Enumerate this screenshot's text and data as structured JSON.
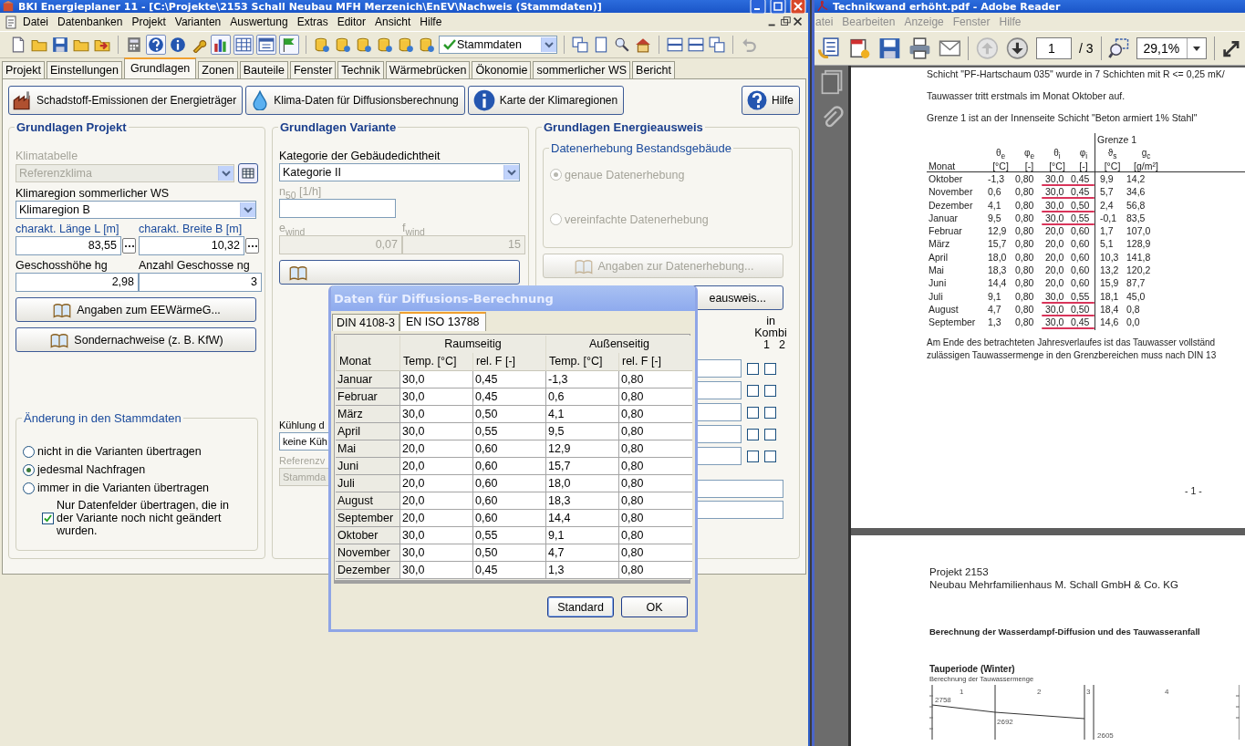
{
  "main_window": {
    "title": "BKI Energieplaner 11 - [C:\\Projekte\\2153 Schall Neubau MFH Merzenich\\EnEV\\Nachweis (Stammdaten)]",
    "menu": [
      "Datei",
      "Datenbanken",
      "Projekt",
      "Varianten",
      "Auswertung",
      "Extras",
      "Editor",
      "Ansicht",
      "Hilfe"
    ],
    "view_select": "Stammdaten",
    "tabs": [
      {
        "label": "Projekt",
        "selected": false
      },
      {
        "label": "Einstellungen",
        "selected": false
      },
      {
        "label": "Grundlagen",
        "selected": true
      },
      {
        "label": "Zonen",
        "selected": false
      },
      {
        "label": "Bauteile",
        "selected": false
      },
      {
        "label": "Fenster",
        "selected": false
      },
      {
        "label": "Technik",
        "selected": false
      },
      {
        "label": "Wärmebrücken",
        "selected": false
      },
      {
        "label": "Ökonomie",
        "selected": false
      },
      {
        "label": "sommerlicher WS",
        "selected": false
      },
      {
        "label": "Bericht",
        "selected": false
      }
    ],
    "action_buttons": [
      {
        "label": "Schadstoff-Emissionen der Energieträger",
        "kind": "factory"
      },
      {
        "label": "Klima-Daten für Diffusionsberechnung",
        "kind": "droplet"
      },
      {
        "label": "Karte der Klimaregionen",
        "kind": "info"
      }
    ],
    "help_button": "Hilfe",
    "project_group": {
      "title": "Grundlagen Projekt",
      "climate_table": {
        "label": "Klimatabelle",
        "value": "Referenzklima",
        "disabled": true
      },
      "summer_region": {
        "label": "Klimaregion sommerlicher WS",
        "value": "Klimaregion B"
      },
      "length": {
        "label": "charakt. Länge L [m]",
        "value": "83,55"
      },
      "width": {
        "label": "charakt. Breite B [m]",
        "value": "10,32"
      },
      "storey_height": {
        "label": "Geschosshöhe hg",
        "value": "2,98"
      },
      "storey_count": {
        "label": "Anzahl Geschosse ng",
        "value": "3"
      },
      "buttons": [
        "Angaben zum EEWärmeG...",
        "Sondernachweise (z. B. KfW)"
      ],
      "changes": {
        "title": "Änderung in den Stammdaten",
        "options": [
          {
            "label": "nicht in die Varianten übertragen",
            "selected": false
          },
          {
            "label": "jedesmal Nachfragen",
            "selected": true
          },
          {
            "label": "immer in die Varianten übertragen",
            "selected": false
          }
        ],
        "only_unchanged": {
          "label": "Nur Datenfelder übertragen, die in der Variante noch nicht geändert wurden.",
          "checked": true
        }
      }
    },
    "variant_group": {
      "title": "Grundlagen Variante",
      "airtightness": {
        "label": "Kategorie der Gebäudedichtheit",
        "value": "Kategorie II"
      },
      "n50": {
        "label": "n$_{50}$  [1/h]",
        "disabled": true
      },
      "e_wind": {
        "label": "e$_{wind}$",
        "value": "0,07",
        "disabled": true
      },
      "f_wind": {
        "label": "f$_{wind}$",
        "value": "15",
        "disabled": true
      },
      "cooling": {
        "label": "Kühlung d",
        "value": "keine Küh"
      },
      "reference": {
        "label": "Referenzv",
        "value": "Stammda",
        "disabled": true
      }
    },
    "certificate_group": {
      "title": "Grundlagen Energieausweis",
      "survey": {
        "title": "Datenerhebung Bestandsgebäude",
        "disabled": true,
        "options": [
          {
            "label": "genaue Datenerhebung",
            "selected": true
          },
          {
            "label": "vereinfachte Datenerhebung",
            "selected": false
          }
        ]
      },
      "survey_button": {
        "label": "Angaben zur Datenerhebung...",
        "disabled": true
      },
      "partial_button": "eausweis...",
      "combi_header": {
        "label": "in Kombi",
        "col_1": "1",
        "col_2": "2"
      },
      "combi_rows": [
        {
          "combi_1": false,
          "combi_2": false
        },
        {
          "combi_1": false,
          "combi_2": false
        },
        {
          "combi_1": false,
          "combi_2": false
        },
        {
          "combi_1": false,
          "combi_2": false
        },
        {
          "combi_1": false,
          "combi_2": false
        }
      ]
    }
  },
  "dialog": {
    "title": "Daten für Diffusions-Berechnung",
    "tabs": [
      {
        "label": "DIN 4108-3",
        "selected": false
      },
      {
        "label": "EN ISO 13788",
        "selected": true
      }
    ],
    "group_headers": [
      "Raumseitig",
      "Außenseitig"
    ],
    "columns": [
      "Monat",
      "Temp. [°C]",
      "rel. F [-]",
      "Temp. [°C]",
      "rel. F [-]"
    ],
    "rows": [
      [
        "Januar",
        "30,0",
        "0,45",
        "-1,3",
        "0,80"
      ],
      [
        "Februar",
        "30,0",
        "0,45",
        "0,6",
        "0,80"
      ],
      [
        "März",
        "30,0",
        "0,50",
        "4,1",
        "0,80"
      ],
      [
        "April",
        "30,0",
        "0,55",
        "9,5",
        "0,80"
      ],
      [
        "Mai",
        "20,0",
        "0,60",
        "12,9",
        "0,80"
      ],
      [
        "Juni",
        "20,0",
        "0,60",
        "15,7",
        "0,80"
      ],
      [
        "Juli",
        "20,0",
        "0,60",
        "18,0",
        "0,80"
      ],
      [
        "August",
        "20,0",
        "0,60",
        "18,3",
        "0,80"
      ],
      [
        "September",
        "20,0",
        "0,60",
        "14,4",
        "0,80"
      ],
      [
        "Oktober",
        "30,0",
        "0,55",
        "9,1",
        "0,80"
      ],
      [
        "November",
        "30,0",
        "0,50",
        "4,7",
        "0,80"
      ],
      [
        "Dezember",
        "30,0",
        "0,45",
        "1,3",
        "0,80"
      ]
    ],
    "buttons": [
      "Standard",
      "OK"
    ]
  },
  "pdf_window": {
    "title": "Technikwand erhöht.pdf - Adobe Reader",
    "menu": [
      "atei",
      "Bearbeiten",
      "Anzeige",
      "Fenster",
      "Hilfe"
    ],
    "page_field": "1",
    "page_total": "/ 3",
    "zoom": "29,1%",
    "page_1": {
      "lines": [
        "Schicht \"PF-Hartschaum 035\" wurde in 7 Schichten mit R <= 0,25 mK/",
        "Tauwasser tritt erstmals im Monat Oktober auf.",
        "Grenze 1 ist an der Innenseite Schicht \"Beton armiert 1% Stahl\""
      ],
      "boundary_header": "Grenze 1",
      "columns": [
        {
          "symbol": "Monat"
        },
        {
          "symbol": "θ$_{e}$",
          "unit": "[°C]"
        },
        {
          "symbol": "φ$_{e}$",
          "unit": "[-]"
        },
        {
          "symbol": "θ$_{i}$",
          "unit": "[°C]"
        },
        {
          "symbol": "φ$_{i}$",
          "unit": "[-]"
        },
        {
          "symbol": "ϑ$_{s}$",
          "unit": "[°C]"
        },
        {
          "symbol": "g$_{c}$",
          "unit": "[g/m²]"
        }
      ],
      "rows": [
        {
          "cells": [
            "Oktober",
            "-1,3",
            "0,80",
            "30,0",
            "0,45",
            "9,9",
            "14,2"
          ],
          "marked": true
        },
        {
          "cells": [
            "November",
            "0,6",
            "0,80",
            "30,0",
            "0,45",
            "5,7",
            "34,6"
          ],
          "marked": true
        },
        {
          "cells": [
            "Dezember",
            "4,1",
            "0,80",
            "30,0",
            "0,50",
            "2,4",
            "56,8"
          ],
          "marked": true
        },
        {
          "cells": [
            "Januar",
            "9,5",
            "0,80",
            "30,0",
            "0,55",
            "-0,1",
            "83,5"
          ],
          "marked": true
        },
        {
          "cells": [
            "Februar",
            "12,9",
            "0,80",
            "20,0",
            "0,60",
            "1,7",
            "107,0"
          ],
          "marked": false
        },
        {
          "cells": [
            "März",
            "15,7",
            "0,80",
            "20,0",
            "0,60",
            "5,1",
            "128,9"
          ],
          "marked": false
        },
        {
          "cells": [
            "April",
            "18,0",
            "0,80",
            "20,0",
            "0,60",
            "10,3",
            "141,8"
          ],
          "marked": false
        },
        {
          "cells": [
            "Mai",
            "18,3",
            "0,80",
            "20,0",
            "0,60",
            "13,2",
            "120,2"
          ],
          "marked": false
        },
        {
          "cells": [
            "Juni",
            "14,4",
            "0,80",
            "20,0",
            "0,60",
            "15,9",
            "87,7"
          ],
          "marked": false
        },
        {
          "cells": [
            "Juli",
            "9,1",
            "0,80",
            "30,0",
            "0,55",
            "18,1",
            "45,0"
          ],
          "marked": true
        },
        {
          "cells": [
            "August",
            "4,7",
            "0,80",
            "30,0",
            "0,50",
            "18,4",
            "0,8"
          ],
          "marked": true
        },
        {
          "cells": [
            "September",
            "1,3",
            "0,80",
            "30,0",
            "0,45",
            "14,6",
            "0,0"
          ],
          "marked": true
        }
      ],
      "closing": [
        "Am Ende des betrachteten Jahresverlaufes ist das Tauwasser vollständ",
        "zulässigen Tauwassermenge in den Grenzbereichen muss nach DIN 13"
      ],
      "page_number": "- 1 -"
    },
    "page_2": {
      "project": "Projekt 2153",
      "client": "Neubau Mehrfamilienhaus M. Schall GmbH & Co. KG",
      "heading": "Berechnung der Wasserdampf-Diffusion und des Tauwasseranfall",
      "chart_title": "Tauperiode (Winter)",
      "chart_subtitle": "Berechnung der Tauwassermenge",
      "layers": [
        "1",
        "2",
        "3",
        "4"
      ],
      "values": [
        "2758",
        "2692",
        "2605"
      ]
    }
  }
}
